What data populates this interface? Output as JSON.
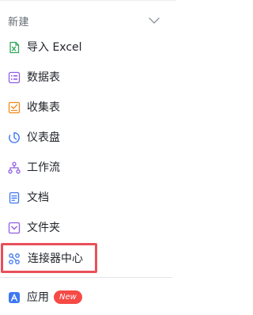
{
  "header": {
    "title": "新建",
    "chevron_icon": "chevron-down-icon"
  },
  "items": [
    {
      "label": "导入 Excel",
      "icon": "excel-icon",
      "color": "#2fa55b"
    },
    {
      "label": "数据表",
      "icon": "table-icon",
      "color": "#8f5ee6"
    },
    {
      "label": "收集表",
      "icon": "form-icon",
      "color": "#f28a17"
    },
    {
      "label": "仪表盘",
      "icon": "dashboard-icon",
      "color": "#3d77f2"
    },
    {
      "label": "工作流",
      "icon": "workflow-icon",
      "color": "#8f5ee6"
    },
    {
      "label": "文档",
      "icon": "document-icon",
      "color": "#3d77f2"
    },
    {
      "label": "文件夹",
      "icon": "folder-icon",
      "color": "#8f5ee6"
    },
    {
      "label": "连接器中心",
      "icon": "connector-icon",
      "color": "#3d77f2",
      "highlighted": true,
      "highlight_color": "#e9505a"
    }
  ],
  "apps": {
    "label": "应用",
    "icon": "app-icon",
    "color": "#3d77f2",
    "badge": "New",
    "badge_color": "#f54a45"
  }
}
